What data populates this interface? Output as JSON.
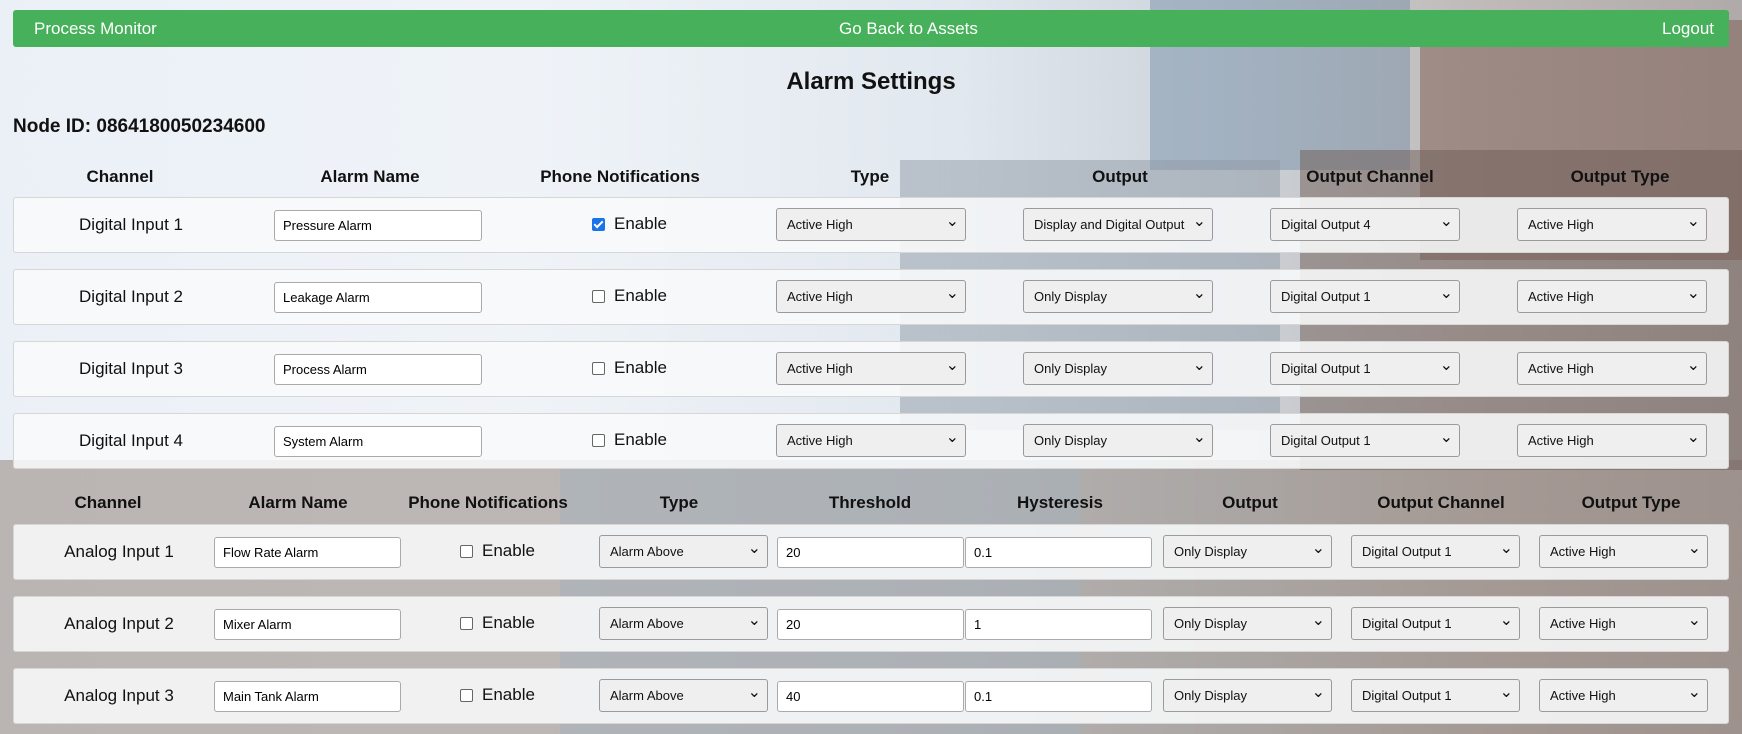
{
  "nav": {
    "brand": "Process Monitor",
    "back": "Go Back to Assets",
    "logout": "Logout"
  },
  "page_title": "Alarm Settings",
  "node_id_label": "Node ID: 0864180050234600",
  "digital_headers": [
    "Channel",
    "Alarm Name",
    "Phone Notifications",
    "Type",
    "Output",
    "Output Channel",
    "Output Type"
  ],
  "analog_headers": [
    "Channel",
    "Alarm Name",
    "Phone Notifications",
    "Type",
    "Threshold",
    "Hysteresis",
    "Output",
    "Output Channel",
    "Output Type"
  ],
  "enable_label": "Enable",
  "digital_rows": [
    {
      "channel": "Digital Input 1",
      "name": "Pressure Alarm",
      "phone": true,
      "type": "Active High",
      "output": "Display and Digital Output",
      "output_channel": "Digital Output 4",
      "output_type": "Active High"
    },
    {
      "channel": "Digital Input 2",
      "name": "Leakage Alarm",
      "phone": false,
      "type": "Active High",
      "output": "Only Display",
      "output_channel": "Digital Output 1",
      "output_type": "Active High"
    },
    {
      "channel": "Digital Input 3",
      "name": "Process Alarm",
      "phone": false,
      "type": "Active High",
      "output": "Only Display",
      "output_channel": "Digital Output 1",
      "output_type": "Active High"
    },
    {
      "channel": "Digital Input 4",
      "name": "System Alarm",
      "phone": false,
      "type": "Active High",
      "output": "Only Display",
      "output_channel": "Digital Output 1",
      "output_type": "Active High"
    }
  ],
  "analog_rows": [
    {
      "channel": "Analog Input 1",
      "name": "Flow Rate Alarm",
      "phone": false,
      "type": "Alarm Above",
      "threshold": "20",
      "hysteresis": "0.1",
      "output": "Only Display",
      "output_channel": "Digital Output 1",
      "output_type": "Active High"
    },
    {
      "channel": "Analog Input 2",
      "name": "Mixer Alarm",
      "phone": false,
      "type": "Alarm Above",
      "threshold": "20",
      "hysteresis": "1",
      "output": "Only Display",
      "output_channel": "Digital Output 1",
      "output_type": "Active High"
    },
    {
      "channel": "Analog Input 3",
      "name": "Main Tank Alarm",
      "phone": false,
      "type": "Alarm Above",
      "threshold": "40",
      "hysteresis": "0.1",
      "output": "Only Display",
      "output_channel": "Digital Output 1",
      "output_type": "Active High"
    }
  ],
  "colors": {
    "navbar": "#47b05a",
    "checkbox_checked": "#1a73e8"
  }
}
